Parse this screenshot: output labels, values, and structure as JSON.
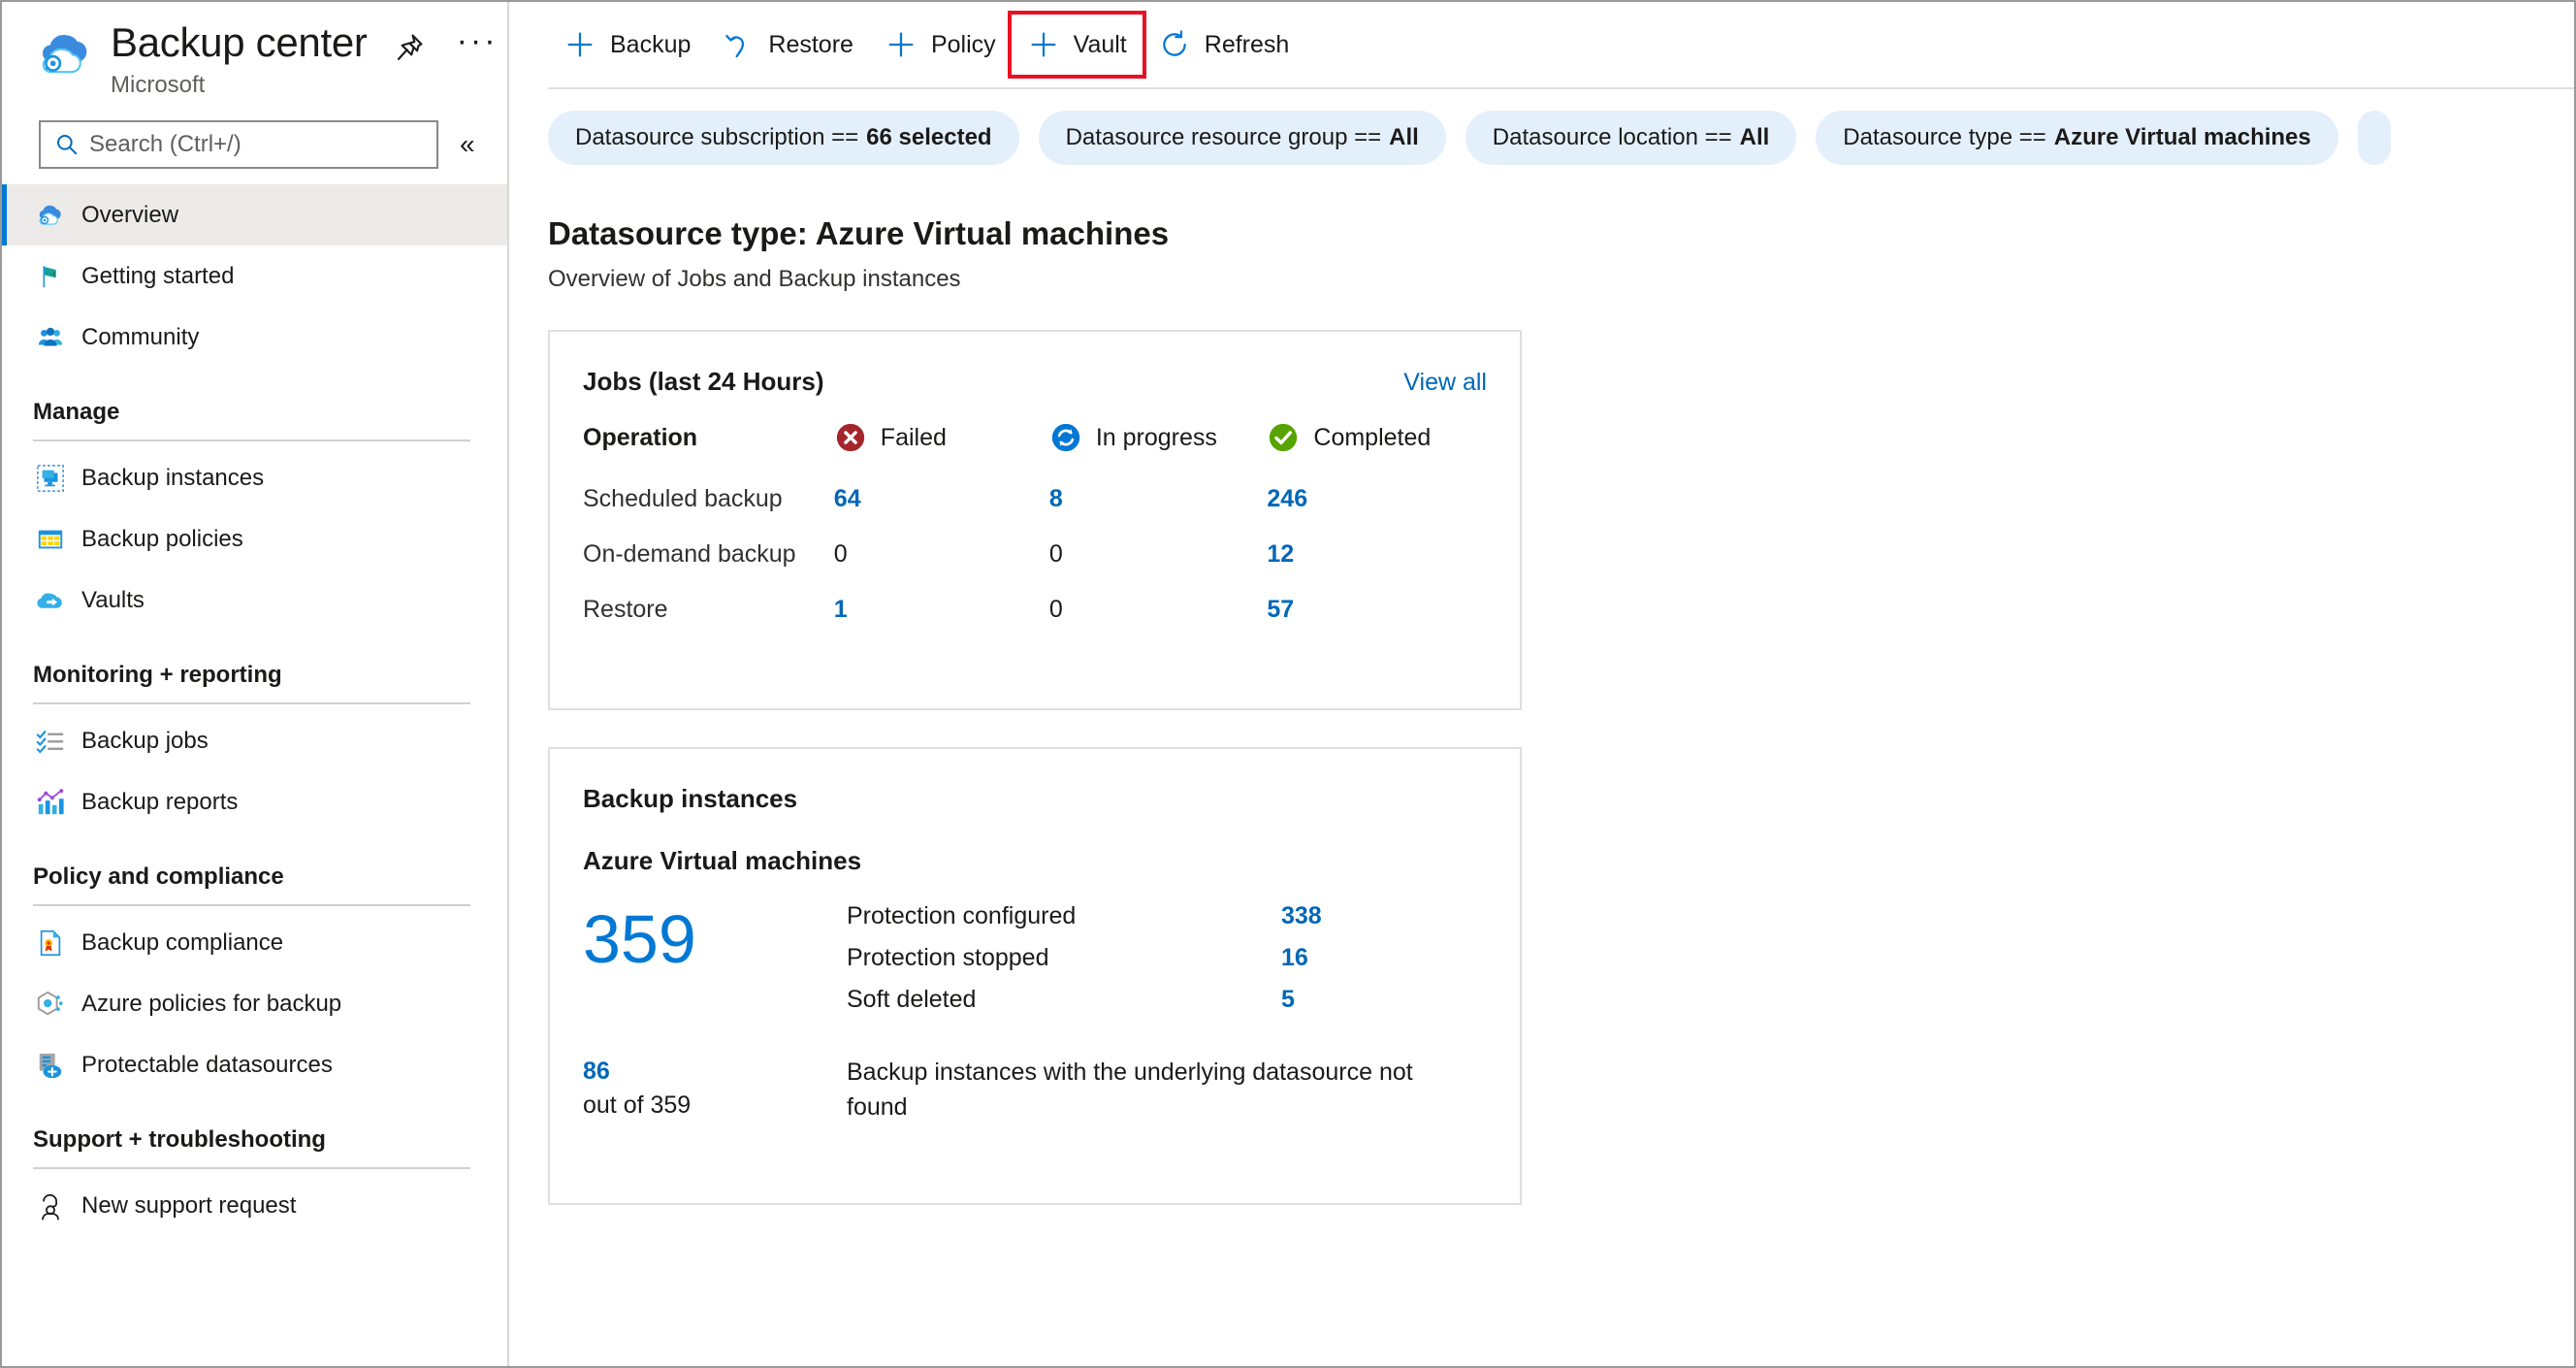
{
  "header": {
    "title": "Backup center",
    "subtitle": "Microsoft",
    "pin_icon": "pin-icon",
    "more_label": "···"
  },
  "search": {
    "placeholder": "Search (Ctrl+/)",
    "value": "",
    "icon": "search-icon",
    "collapse_label": "«"
  },
  "sidebar": {
    "items": [
      {
        "label": "Overview",
        "icon": "backup-center-icon",
        "selected": true
      },
      {
        "label": "Getting started",
        "icon": "flag-icon",
        "selected": false
      },
      {
        "label": "Community",
        "icon": "community-icon",
        "selected": false
      }
    ],
    "groups": [
      {
        "title": "Manage",
        "items": [
          {
            "label": "Backup instances",
            "icon": "backup-instances-icon"
          },
          {
            "label": "Backup policies",
            "icon": "backup-policies-icon"
          },
          {
            "label": "Vaults",
            "icon": "vault-icon"
          }
        ]
      },
      {
        "title": "Monitoring + reporting",
        "items": [
          {
            "label": "Backup jobs",
            "icon": "checklist-icon"
          },
          {
            "label": "Backup reports",
            "icon": "bar-chart-icon"
          }
        ]
      },
      {
        "title": "Policy and compliance",
        "items": [
          {
            "label": "Backup compliance",
            "icon": "compliance-document-icon"
          },
          {
            "label": "Azure policies for backup",
            "icon": "azure-policy-icon"
          },
          {
            "label": "Protectable datasources",
            "icon": "protectable-datasource-icon"
          }
        ]
      },
      {
        "title": "Support + troubleshooting",
        "items": [
          {
            "label": "New support request",
            "icon": "support-person-icon"
          }
        ]
      }
    ]
  },
  "toolbar": {
    "buttons": [
      {
        "label": "Backup",
        "icon": "plus-icon",
        "highlighted": false
      },
      {
        "label": "Restore",
        "icon": "restore-arrow-icon",
        "highlighted": false
      },
      {
        "label": "Policy",
        "icon": "plus-icon",
        "highlighted": false
      },
      {
        "label": "Vault",
        "icon": "plus-icon",
        "highlighted": true
      },
      {
        "label": "Refresh",
        "icon": "refresh-icon",
        "highlighted": false
      }
    ]
  },
  "filters": [
    {
      "field": "Datasource subscription",
      "operator": "==",
      "value": "66 selected"
    },
    {
      "field": "Datasource resource group",
      "operator": "==",
      "value": "All"
    },
    {
      "field": "Datasource location",
      "operator": "==",
      "value": "All"
    },
    {
      "field": "Datasource type",
      "operator": "==",
      "value": "Azure Virtual machines"
    }
  ],
  "page": {
    "title": "Datasource type: Azure Virtual machines",
    "subtitle": "Overview of Jobs and Backup instances"
  },
  "jobs_card": {
    "title": "Jobs (last 24 Hours)",
    "view_all_label": "View all",
    "columns": [
      {
        "label": "Operation",
        "icon": null
      },
      {
        "label": "Failed",
        "icon": "error-circle-icon",
        "color": "#a4262c"
      },
      {
        "label": "In progress",
        "icon": "in-progress-circle-icon",
        "color": "#0078d4"
      },
      {
        "label": "Completed",
        "icon": "success-circle-icon",
        "color": "#57a300"
      }
    ],
    "rows": [
      {
        "operation": "Scheduled backup",
        "failed": "64",
        "in_progress": "8",
        "completed": "246"
      },
      {
        "operation": "On-demand backup",
        "failed": "0",
        "in_progress": "0",
        "completed": "12"
      },
      {
        "operation": "Restore",
        "failed": "1",
        "in_progress": "0",
        "completed": "57"
      }
    ]
  },
  "instances_card": {
    "title": "Backup instances",
    "datasource_type": "Azure Virtual machines",
    "total": "359",
    "stats": [
      {
        "label": "Protection configured",
        "value": "338"
      },
      {
        "label": "Protection stopped",
        "value": "16"
      },
      {
        "label": "Soft deleted",
        "value": "5"
      }
    ],
    "not_found": {
      "count": "86",
      "out_of": "out of 359",
      "description": "Backup instances with the underlying datasource not found"
    }
  },
  "colors": {
    "accent": "#0078d4",
    "link": "#0067b8",
    "failed": "#a4262c",
    "in_progress": "#0078d4",
    "completed": "#57a300",
    "highlight_box": "#e81123",
    "pill_bg": "#e3f0fb",
    "selected_bg": "#edebe9"
  }
}
